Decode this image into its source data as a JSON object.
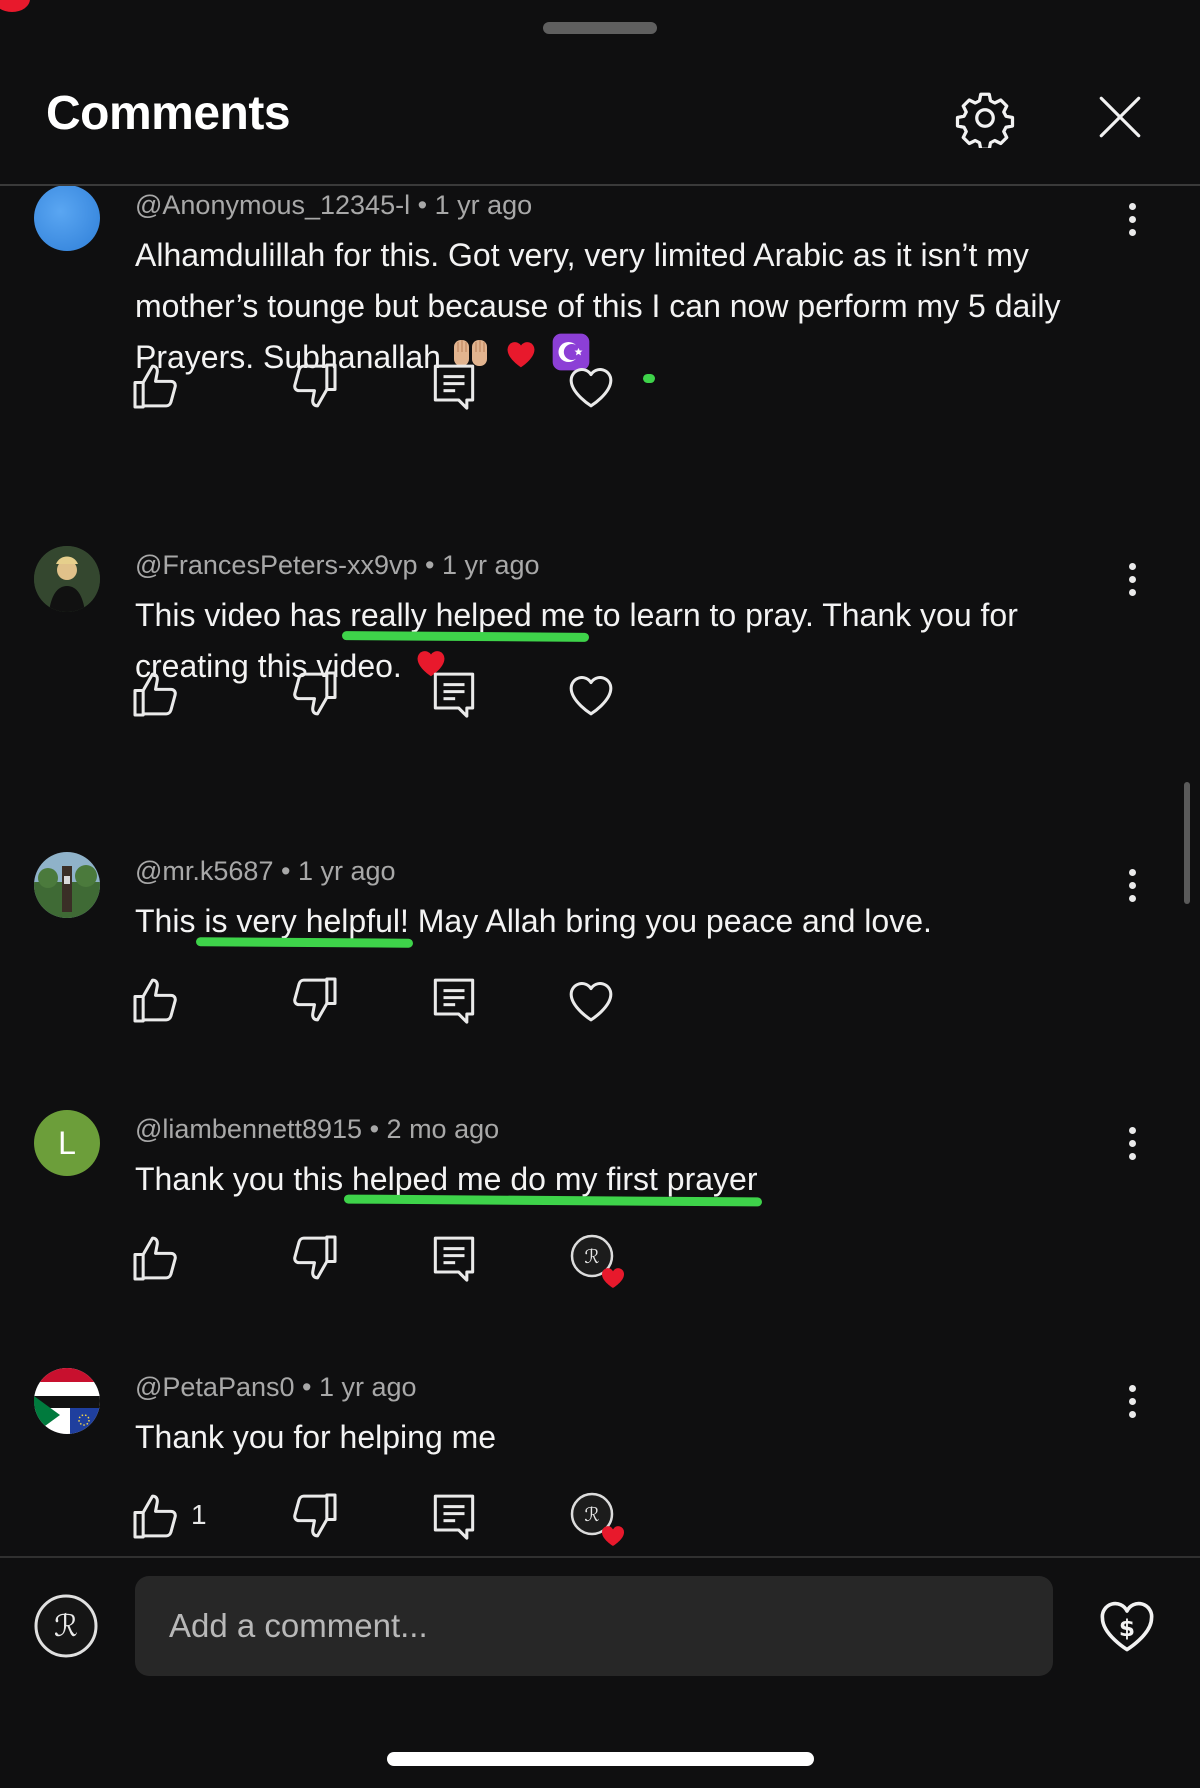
{
  "header": {
    "title": "Comments",
    "settings_icon": "gear-icon",
    "close_icon": "close-icon"
  },
  "comments": [
    {
      "handle": "@Anonymous_12345-l",
      "time": "1 yr ago",
      "text_before": "Alhamdulillah for this. Got very, very limited Arabic as it isn’t my mother’s tounge but because of this ",
      "text_highlight": "I can now perform my 5 daily Prayers",
      "text_after": ". Subhanallah",
      "emojis": [
        "raising-hands-emoji",
        "red-heart-emoji",
        "star-and-crescent-emoji"
      ],
      "avatar_color": "#3b8fe6",
      "likes": "",
      "hearted_by_creator": false
    },
    {
      "handle": "@FrancesPeters-xx9vp",
      "time": "1 yr ago",
      "text_before": "This video has ",
      "text_highlight": "really helped me",
      "text_after": " to learn to pray. Thank you for creating this video.",
      "emojis": [
        "red-heart-emoji"
      ],
      "likes": "",
      "hearted_by_creator": false
    },
    {
      "handle": "@mr.k5687",
      "time": "1 yr ago",
      "text_before": "This ",
      "text_highlight": "is very helpful!",
      "text_after": " May Allah bring you peace and love.",
      "emojis": [],
      "likes": "",
      "hearted_by_creator": false
    },
    {
      "handle": "@liambennett8915",
      "time": "2 mo ago",
      "avatar_letter": "L",
      "avatar_color": "#6c9e3a",
      "text_before": "Thank you this ",
      "text_highlight": "helped me do my first prayer",
      "text_after": "",
      "emojis": [],
      "likes": "",
      "hearted_by_creator": true
    },
    {
      "handle": "@PetaPans0",
      "time": "1 yr ago",
      "text_before": "Thank you for helping me",
      "text_highlight": "",
      "text_after": "",
      "emojis": [],
      "likes": "1",
      "hearted_by_creator": true
    }
  ],
  "composer": {
    "placeholder": "Add a comment...",
    "thanks_icon": "super-thanks-icon"
  },
  "colors": {
    "background": "#0f0f10",
    "highlight_underline": "#3ed34a",
    "heart_red": "#e8192c"
  }
}
